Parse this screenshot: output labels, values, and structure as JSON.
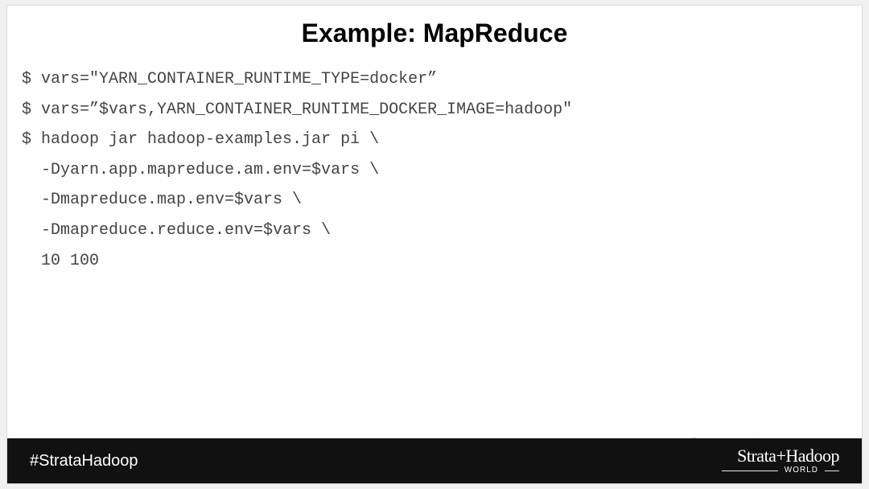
{
  "title": "Example: MapReduce",
  "code": {
    "l1": "$ vars=\"YARN_CONTAINER_RUNTIME_TYPE=docker”",
    "l2": "$ vars=”$vars,YARN_CONTAINER_RUNTIME_DOCKER_IMAGE=hadoop\"",
    "l3": "$ hadoop jar hadoop-examples.jar pi \\",
    "l4": "  -Dyarn.app.mapreduce.am.env=$vars \\",
    "l5": "  -Dmapreduce.map.env=$vars \\",
    "l6": "  -Dmapreduce.reduce.env=$vars \\",
    "l7": "  10 100"
  },
  "footer": {
    "hashtag": "#StrataHadoop",
    "logo_main": "Strata+Hadoop",
    "logo_sub": "WORLD"
  },
  "watermark": {
    "text": "大数据技术圈"
  }
}
